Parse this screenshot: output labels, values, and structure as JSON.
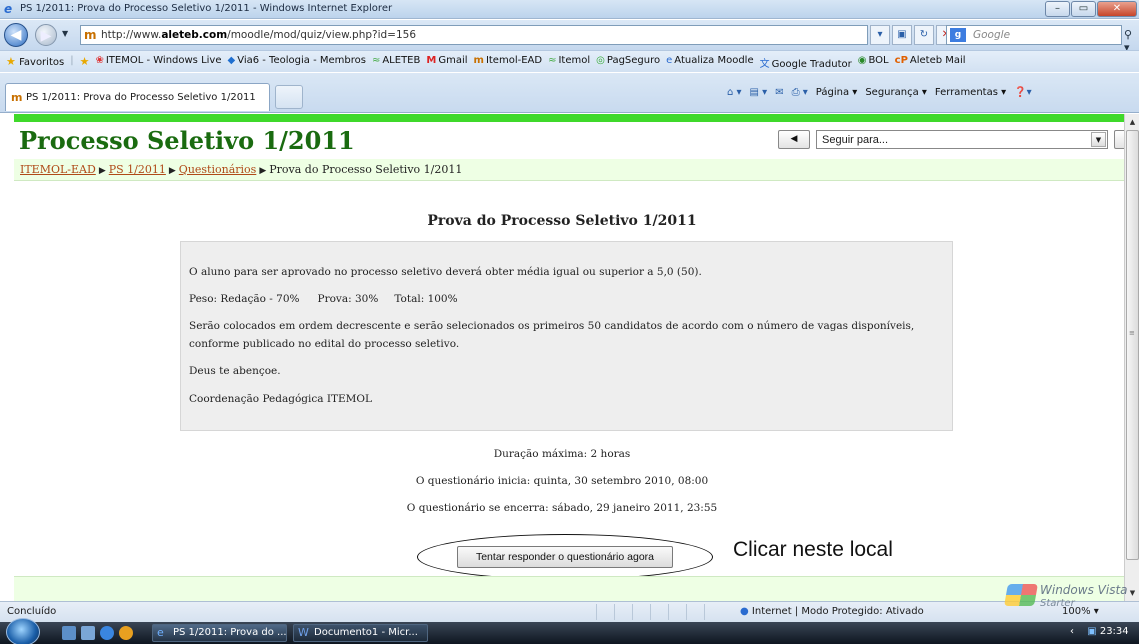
{
  "window": {
    "title": "PS 1/2011: Prova do Processo Seletivo 1/2011 - Windows Internet Explorer",
    "buttons": [
      "–",
      "▭",
      "✕"
    ]
  },
  "address_bar": {
    "url_prefix": "http://www.",
    "url_domain": "aleteb.com",
    "url_path": "/moodle/mod/quiz/view.php?id=156",
    "search_placeholder": "Google"
  },
  "favorites_bar": {
    "label": "Favoritos",
    "items": [
      "ITEMOL - Windows Live",
      "Via6 - Teologia - Membros",
      "ALETEB",
      "Gmail",
      "Itemol-EAD",
      "Itemol",
      "PagSeguro",
      "Atualiza Moodle",
      "Google Tradutor",
      "BOL",
      "Aleteb Mail"
    ]
  },
  "tab": {
    "label": "PS 1/2011: Prova do Processo Seletivo 1/2011"
  },
  "command_bar": {
    "page": "Página",
    "security": "Segurança",
    "tools": "Ferramentas"
  },
  "page": {
    "heading": "Processo Seletivo 1/2011",
    "jump_select": "Seguir para...",
    "breadcrumb": [
      "ITEMOL-EAD",
      "PS 1/2011",
      "Questionários",
      "Prova do Processo Seletivo 1/2011"
    ],
    "quiz_title": "Prova do Processo Seletivo 1/2011",
    "intro": {
      "line1": "O aluno para ser aprovado no processo seletivo deverá obter média igual ou superior a 5,0 (50).",
      "weights": [
        "Peso: Redação - 70%",
        "Prova: 30%",
        "Total: 100%"
      ],
      "line3a": "Serão colocados em ordem decrescente e serão selecionados os primeiros 50 candidatos de acordo com o número de vagas disponíveis,",
      "line3b": "conforme publicado no edital do processo seletivo.",
      "line4": "Deus te abençoe.",
      "line5": "Coordenação Pedagógica ITEMOL"
    },
    "duration": "Duração máxima: 2 horas",
    "opens": "O questionário inicia: quinta, 30 setembro 2010, 08:00",
    "closes": "O questionário se encerra: sábado, 29 janeiro 2011, 23:55",
    "start_button": "Tentar responder o questionário agora",
    "annotation": "Clicar neste local"
  },
  "status_bar": {
    "status": "Concluído",
    "zone": "Internet | Modo Protegido: Ativado",
    "zoom": "100%"
  },
  "watermark": {
    "line1": "Windows Vista",
    "line2": "Starter"
  },
  "taskbar": {
    "items": [
      "PS 1/2011: Prova do ...",
      "Documento1 - Micr..."
    ],
    "clock": "23:34"
  }
}
